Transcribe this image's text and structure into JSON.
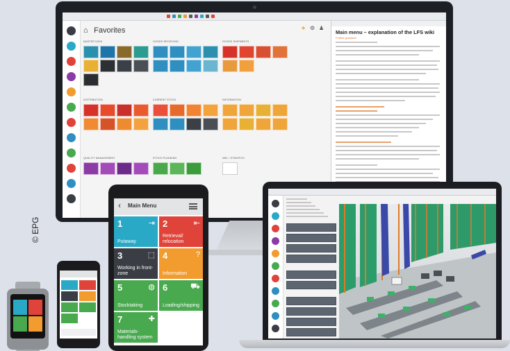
{
  "desktop": {
    "page_title": "Favorites",
    "group_labels": [
      "MASTER DATA",
      "GOODS RECEIVING",
      "GOODS SHIPMENTS",
      "DISTRIBUTION",
      "CURRENT STOCK",
      "INFORMATION",
      "QUALITY MANAGEMENT",
      "STOCK PLANNING",
      "ABC / STRATEGY"
    ],
    "tile_groups": [
      {
        "tiles": [
          "#2b8fae",
          "#1f74a8",
          "#8a6a2c",
          "#2b9c8f",
          "#e8b034",
          "#2c2f33",
          "#3b4046",
          "#4a4f55",
          "#2a2d31"
        ]
      },
      {
        "tiles": [
          "#2f8fc0",
          "#2f8fc0",
          "#42a3d0",
          "#2b8fae",
          "#2f8fc0",
          "#2f8fc0",
          "#42a3d0",
          "#6ab5cf"
        ]
      },
      {
        "tiles": [
          "#d63229",
          "#e0452f",
          "#d94f33",
          "#e0723a",
          "#e89b3c",
          "#f2a03d"
        ]
      },
      {
        "tiles": [
          "#d63229",
          "#e84a2c",
          "#c9302c",
          "#e95b2f",
          "#f08a33",
          "#d6532a",
          "#ee8a2f",
          "#f2a33f"
        ]
      },
      {
        "tiles": [
          "#e94f3a",
          "#e56a2c",
          "#f08432",
          "#f4a23d",
          "#2f8fc0",
          "#2f8fc0",
          "#3b4046",
          "#4a4f55"
        ]
      },
      {
        "tiles": [
          "#f0a53a",
          "#f0a53a",
          "#e8b034",
          "#f0a53a",
          "#f0a53a",
          "#e8b034",
          "#f0a53a",
          "#f0a53a"
        ]
      },
      {
        "tiles": [
          "#8b3aa6",
          "#a34bb8",
          "#6c2b8a",
          "#a34bb8"
        ]
      },
      {
        "tiles": [
          "#4aa84a",
          "#5bb65a",
          "#3c9c3c"
        ]
      },
      {
        "tiles": [
          "#ffffff"
        ]
      }
    ],
    "wiki": {
      "title": "Main menu – explanation of the LFS wiki",
      "subtitle": "Further guidance"
    }
  },
  "tablet": {
    "header": "Main Menu",
    "tiles": [
      {
        "num": "1",
        "label": "Putaway",
        "icon": "login-icon",
        "glyph": "⇥",
        "color": "#2aa9c7"
      },
      {
        "num": "2",
        "label": "Retrieval/ relocation",
        "icon": "logout-icon",
        "glyph": "⇤",
        "color": "#e0433a"
      },
      {
        "num": "3",
        "label": "Working in front-zone",
        "icon": "frame-icon",
        "glyph": "⬚",
        "color": "#3a3e44"
      },
      {
        "num": "4",
        "label": "Information",
        "icon": "info-icon",
        "glyph": "?",
        "color": "#f29b2f"
      },
      {
        "num": "5",
        "label": "Stocktaking",
        "icon": "globe-icon",
        "glyph": "◍",
        "color": "#48a94f"
      },
      {
        "num": "6",
        "label": "Loading/shipping",
        "icon": "truck-icon",
        "glyph": "⛟",
        "color": "#48a94f"
      },
      {
        "num": "7",
        "label": "Materials-handling system",
        "icon": "move-icon",
        "glyph": "✚",
        "color": "#48a94f"
      }
    ]
  },
  "copyright": "© EPG",
  "colors": {
    "accent_orange": "#e8702b",
    "device_dark": "#1b1d22"
  }
}
